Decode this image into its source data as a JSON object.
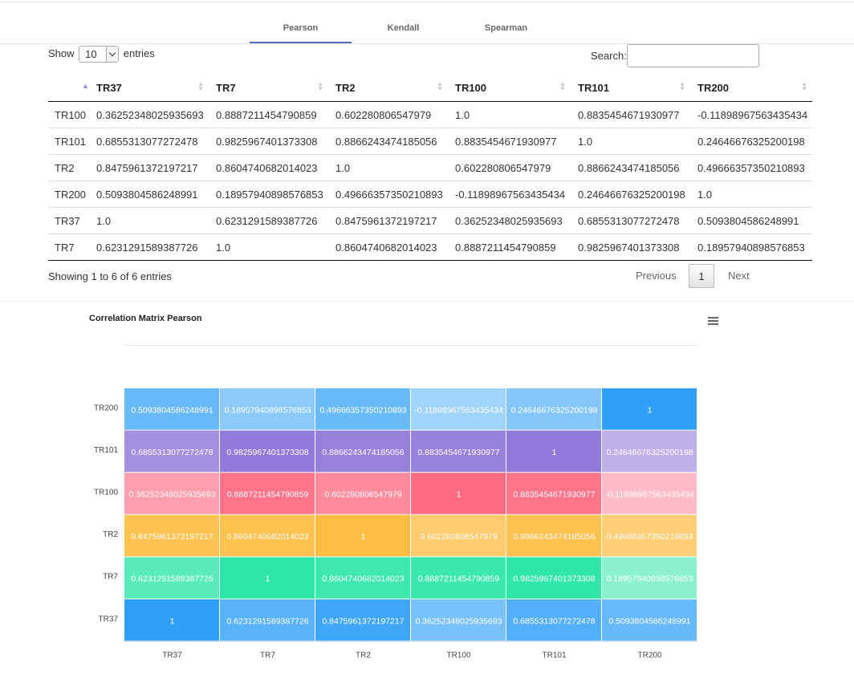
{
  "tabs": [
    {
      "label": "Pearson",
      "active": true
    },
    {
      "label": "Kendall",
      "active": false
    },
    {
      "label": "Spearman",
      "active": false
    }
  ],
  "length_menu": {
    "before": "Show",
    "value": "10",
    "after": "entries"
  },
  "search": {
    "label": "Search:",
    "value": ""
  },
  "table": {
    "columns": [
      "",
      "TR37",
      "TR7",
      "TR2",
      "TR100",
      "TR101",
      "TR200"
    ],
    "rows": [
      [
        "TR100",
        "0.36252348025935693",
        "0.8887211454790859",
        "0.602280806547979",
        "1.0",
        "0.8835454671930977",
        "-0.11898967563435434"
      ],
      [
        "TR101",
        "0.6855313077272478",
        "0.9825967401373308",
        "0.8866243474185056",
        "0.8835454671930977",
        "1.0",
        "0.24646676325200198"
      ],
      [
        "TR2",
        "0.8475961372197217",
        "0.8604740682014023",
        "1.0",
        "0.602280806547979",
        "0.8866243474185056",
        "0.49666357350210893"
      ],
      [
        "TR200",
        "0.5093804586248991",
        "0.18957940898576853",
        "0.49666357350210893",
        "-0.11898967563435434",
        "0.24646676325200198",
        "1.0"
      ],
      [
        "TR37",
        "1.0",
        "0.6231291589387726",
        "0.8475961372197217",
        "0.36252348025935693",
        "0.6855313077272478",
        "0.5093804586248991"
      ],
      [
        "TR7",
        "0.6231291589387726",
        "1.0",
        "0.8604740682014023",
        "0.8887211454790859",
        "0.9825967401373308",
        "0.18957940898576853"
      ]
    ]
  },
  "info": "Showing 1 to 6 of 6 entries",
  "pagination": {
    "previous": "Previous",
    "page": "1",
    "next": "Next"
  },
  "chart_data": {
    "type": "heatmap",
    "title": "Correlation Matrix Pearson",
    "x_categories": [
      "TR37",
      "TR7",
      "TR2",
      "TR100",
      "TR101",
      "TR200"
    ],
    "y_categories": [
      "TR37",
      "TR7",
      "TR2",
      "TR100",
      "TR101",
      "TR200"
    ],
    "row_colors": [
      "#2f9ff7",
      "#2ee6a8",
      "#ffbd43",
      "#ff6b81",
      "#9079d9",
      "#2f9ff7"
    ],
    "values": [
      [
        1,
        0.6231291589387726,
        0.8475961372197217,
        0.36252348025935693,
        0.6855313077272478,
        0.5093804586248991
      ],
      [
        0.6231291589387726,
        1,
        0.8604740682014023,
        0.8887211454790859,
        0.9825967401373308,
        0.18957940898576853
      ],
      [
        0.8475961372197217,
        0.8604740682014023,
        1,
        0.602280806547979,
        0.8866243474185056,
        0.49666357350210893
      ],
      [
        0.36252348025935693,
        0.8887211454790859,
        0.602280806547979,
        1,
        0.8835454671930977,
        -0.11898967563435434
      ],
      [
        0.6855313077272478,
        0.9825967401373308,
        0.8866243474185056,
        0.8835454671930977,
        1,
        0.24646676325200198
      ],
      [
        0.5093804586248991,
        0.18957940898576853,
        0.49666357350210893,
        -0.11898967563435434,
        0.24646676325200198,
        1
      ]
    ],
    "menu_icon": "hamburger-menu-icon"
  }
}
